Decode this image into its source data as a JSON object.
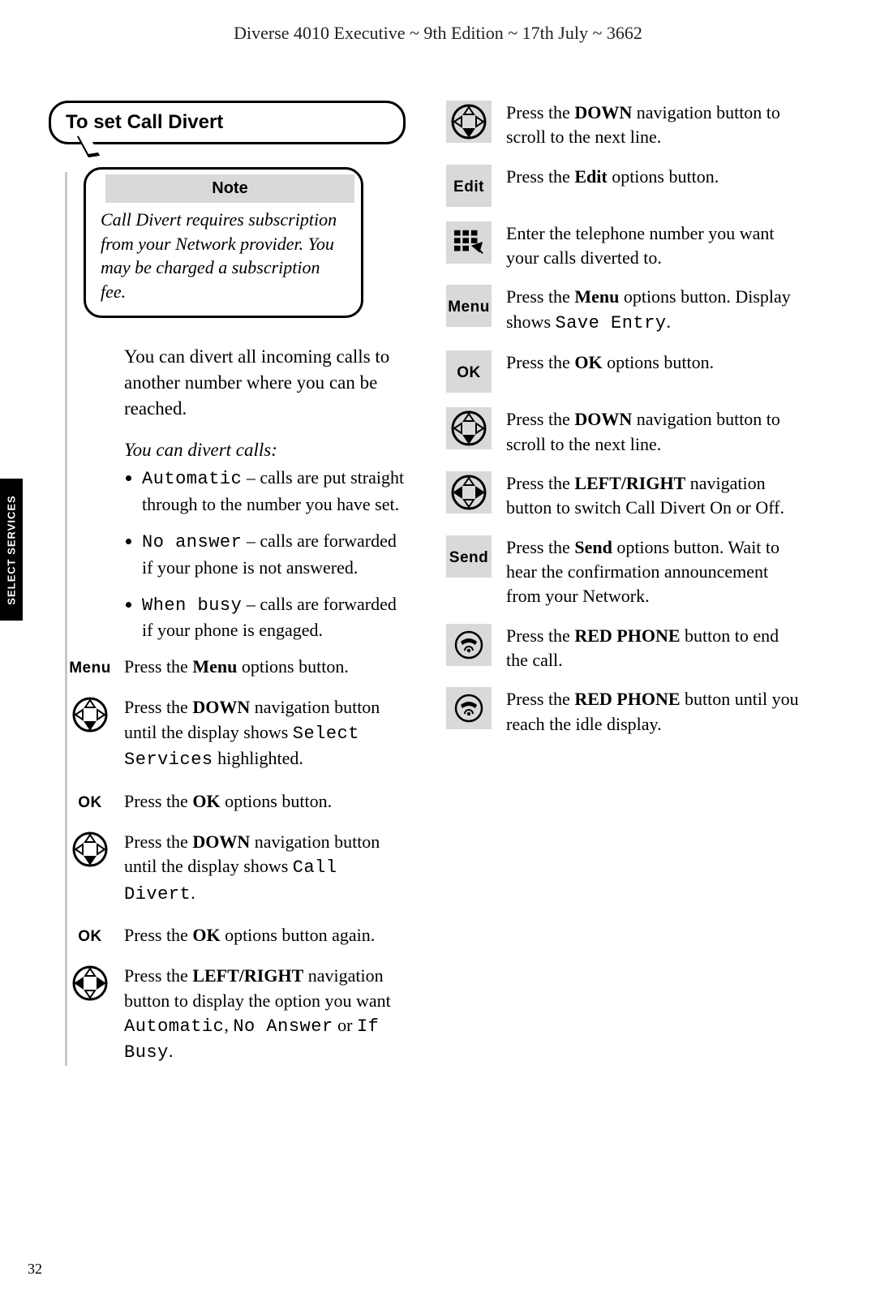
{
  "header": "Diverse 4010 Executive ~ 9th Edition ~ 17th July ~ 3662",
  "side_tab": "SELECT SERVICES",
  "page_number": "32",
  "title": "To set Call Divert",
  "note": {
    "label": "Note",
    "body": "Call Divert requires subscription from your Network provider. You may be charged a subscription fee."
  },
  "intro": "You can divert all incoming calls to another number where you can be reached.",
  "divert_heading": "You can divert calls:",
  "bullets": {
    "auto_code": "Automatic",
    "auto_rest": " – calls are put straight through to the number you have set.",
    "noans_code": "No answer",
    "noans_rest": " – calls are forwarded if your phone is not answered.",
    "busy_code": "When busy",
    "busy_rest": " – calls are forwarded if your phone is engaged."
  },
  "left_steps": [
    {
      "kind": "label",
      "label": "Menu",
      "pre": "Press the ",
      "bold": "Menu",
      "post": " options button."
    },
    {
      "kind": "nav-down",
      "pre": "Press the ",
      "bold": "DOWN",
      "post": " navigation button until the display shows ",
      "code": "Select Services",
      "post2": " highlighted."
    },
    {
      "kind": "label",
      "label": "OK",
      "pre": "Press the ",
      "bold": "OK",
      "post": " options button."
    },
    {
      "kind": "nav-down",
      "pre": "Press the ",
      "bold": "DOWN",
      "post": " navigation button until the display shows ",
      "code": "Call Divert",
      "post2": "."
    },
    {
      "kind": "label",
      "label": "OK",
      "pre": "Press the ",
      "bold": "OK",
      "post": " options button again."
    },
    {
      "kind": "nav-lr",
      "pre": "Press the ",
      "bold": "LEFT/RIGHT",
      "post": " navigation button to display the option you want ",
      "code": "Automatic",
      "post2": ", ",
      "code2": "No Answer",
      "post3": " or ",
      "code3": "If Busy",
      "post4": "."
    }
  ],
  "right_steps": [
    {
      "kind": "nav-down",
      "pre": "Press the ",
      "bold": "DOWN",
      "post": " navigation button to scroll to the next line."
    },
    {
      "kind": "label",
      "label": "Edit",
      "pre": "Press the ",
      "bold": "Edit",
      "post": " options button."
    },
    {
      "kind": "keypad",
      "plain": "Enter the telephone number you want your calls diverted to."
    },
    {
      "kind": "label",
      "label": "Menu",
      "pre": "Press the ",
      "bold": "Menu",
      "post": " options button. Display shows ",
      "code": "Save Entry",
      "post2": "."
    },
    {
      "kind": "label",
      "label": "OK",
      "pre": "Press the ",
      "bold": "OK",
      "post": " options button."
    },
    {
      "kind": "nav-down",
      "pre": "Press the ",
      "bold": "DOWN",
      "post": " navigation button to scroll to the next line."
    },
    {
      "kind": "nav-lr",
      "pre": "Press the ",
      "bold": "LEFT/RIGHT",
      "post": " navigation button to switch Call Divert On or Off."
    },
    {
      "kind": "label",
      "label": "Send",
      "pre": "Press the ",
      "bold": "Send",
      "post": " options button. Wait to hear the confirmation announcement from your Network."
    },
    {
      "kind": "phone",
      "pre": "Press the ",
      "bold": "RED PHONE",
      "post": " button to end the call."
    },
    {
      "kind": "phone",
      "pre": "Press the ",
      "bold": "RED PHONE",
      "post": " button until you reach the idle display."
    }
  ]
}
